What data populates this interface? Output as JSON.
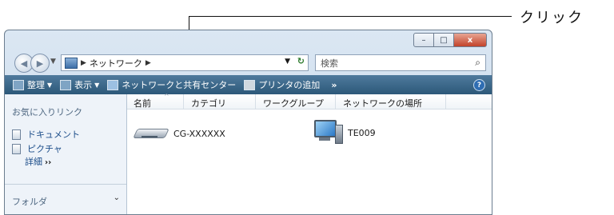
{
  "callout": {
    "label": "クリック"
  },
  "window": {
    "buttons": {
      "minimize": "–",
      "maximize": "□",
      "close": "x"
    },
    "address": {
      "icon": "network-icon",
      "path": [
        "ネットワーク"
      ]
    },
    "search": {
      "placeholder": "検索"
    }
  },
  "toolbar": {
    "items": [
      {
        "label": "整理",
        "has_dropdown": true
      },
      {
        "label": "表示",
        "has_dropdown": true
      },
      {
        "label": "ネットワークと共有センター",
        "has_dropdown": false
      },
      {
        "label": "プリンタの追加",
        "has_dropdown": false
      }
    ],
    "more": "»",
    "help": "?"
  },
  "sidebar": {
    "favorites_title": "お気に入りリンク",
    "links": [
      "ドキュメント",
      "ピクチャ"
    ],
    "detail": "詳細",
    "detail_marker": "››",
    "folders": "フォルダ"
  },
  "columns": [
    "名前",
    "カテゴリ",
    "ワークグループ",
    "ネットワークの場所"
  ],
  "items": [
    {
      "name": "CG-XXXXXX",
      "icon": "router-icon"
    },
    {
      "name": "TE009",
      "icon": "computer-icon"
    }
  ],
  "colors": {
    "toolbar": "#2c5879",
    "accent": "#1d4e8a",
    "close": "#c2432a"
  }
}
